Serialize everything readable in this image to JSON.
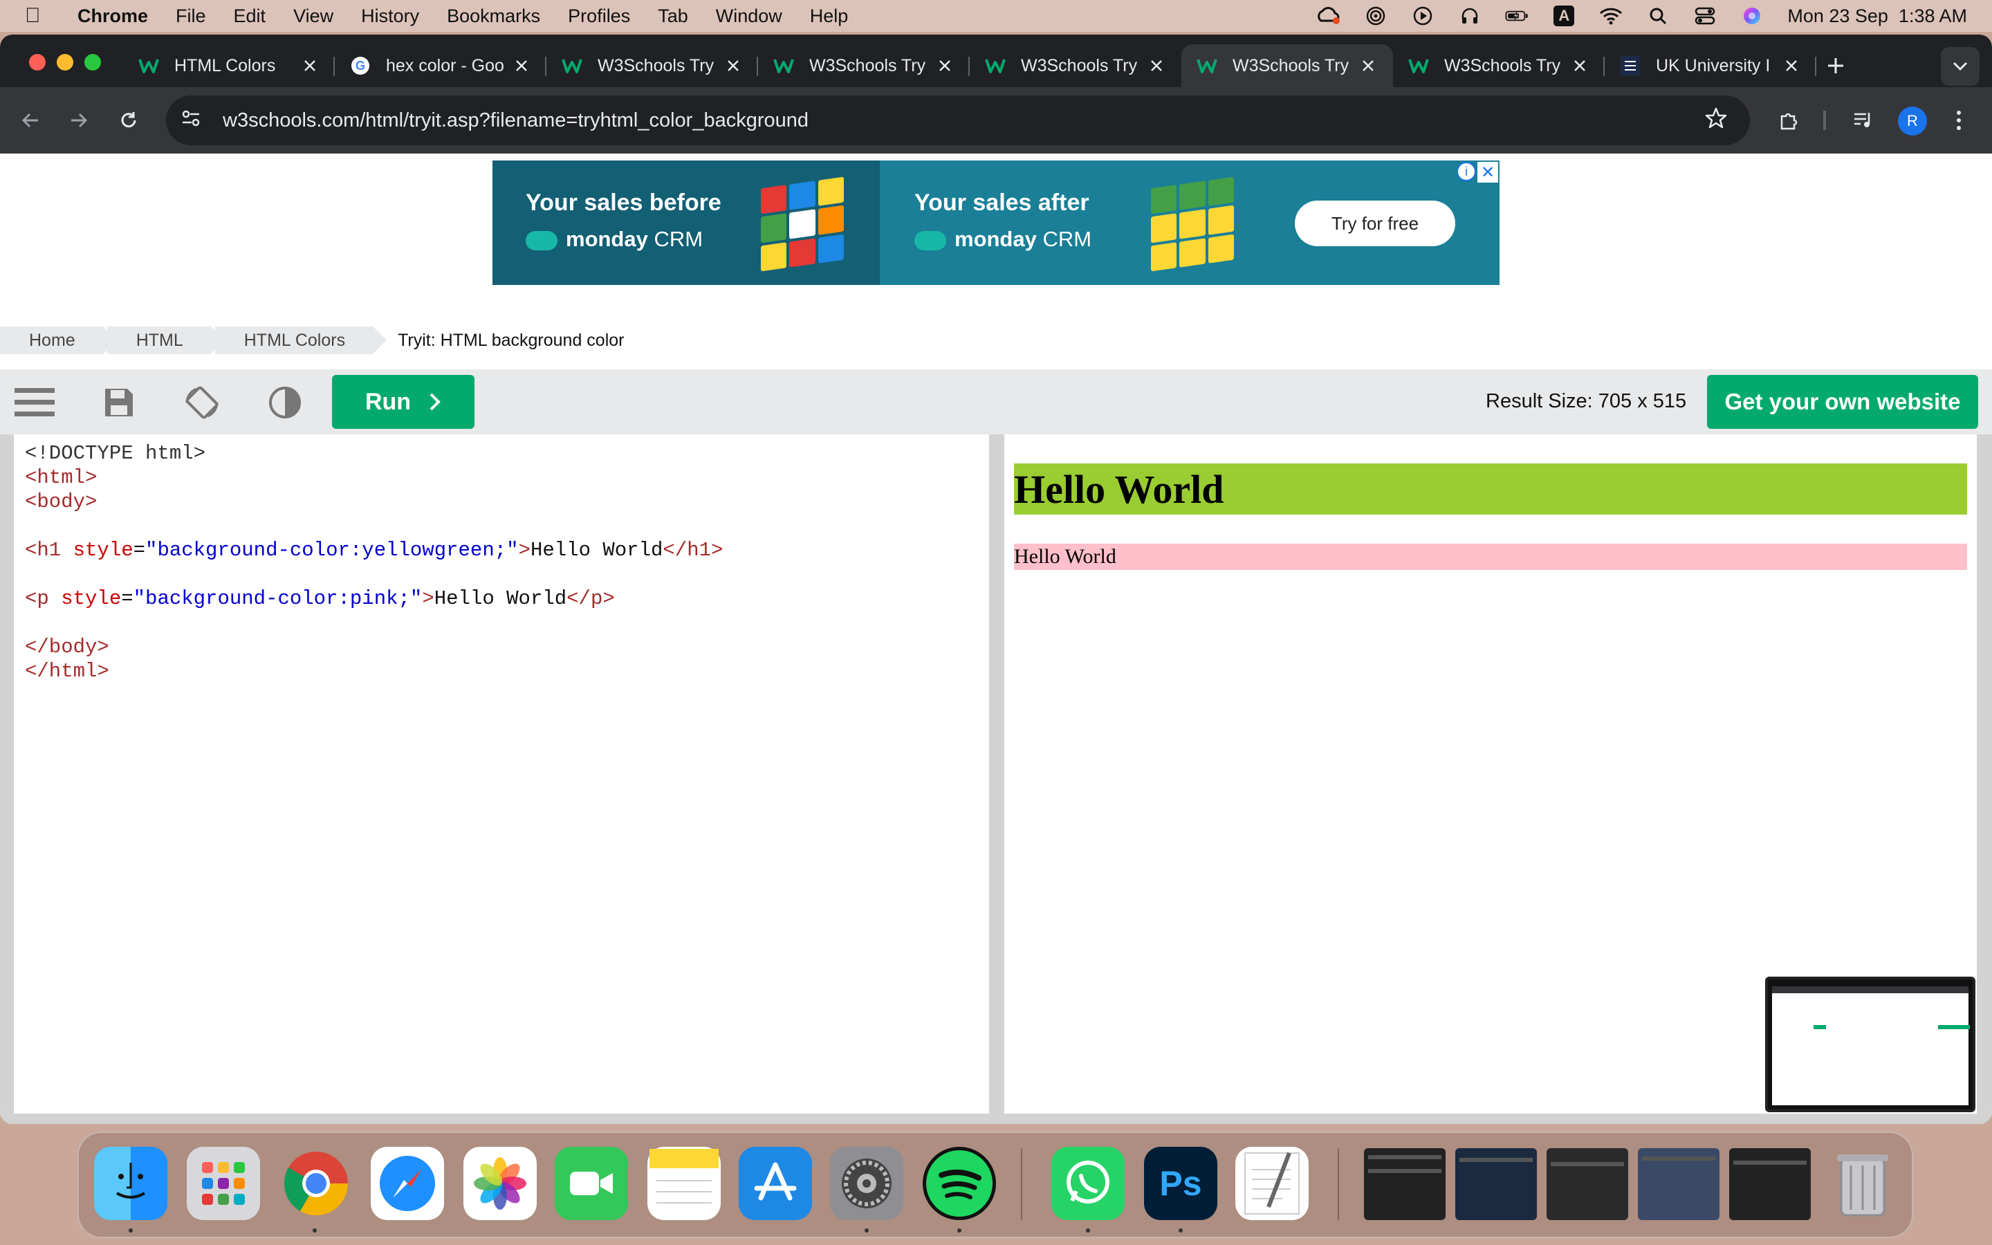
{
  "menubar": {
    "app": "Chrome",
    "items": [
      "File",
      "Edit",
      "View",
      "History",
      "Bookmarks",
      "Profiles",
      "Tab",
      "Window",
      "Help"
    ],
    "status_icons": [
      "creative-cloud-icon",
      "airdrop-icon",
      "play-icon",
      "headphones-icon",
      "battery-icon",
      "input-source-icon",
      "wifi-icon",
      "spotlight-icon",
      "control-center-icon",
      "siri-icon"
    ],
    "input_source": "A",
    "datetime": "Mon 23 Sep  1:38 AM"
  },
  "browser": {
    "tabs": [
      {
        "title": "HTML Colors",
        "favicon": "w3schools-icon"
      },
      {
        "title": "hex color - Goo",
        "favicon": "google-icon"
      },
      {
        "title": "W3Schools Try",
        "favicon": "w3schools-icon"
      },
      {
        "title": "W3Schools Try",
        "favicon": "w3schools-icon"
      },
      {
        "title": "W3Schools Try",
        "favicon": "w3schools-icon"
      },
      {
        "title": "W3Schools Try",
        "favicon": "w3schools-icon",
        "active": true
      },
      {
        "title": "W3Schools Try",
        "favicon": "w3schools-icon"
      },
      {
        "title": "UK University I",
        "favicon": "bath-spa-icon"
      }
    ],
    "url": "w3schools.com/html/tryit.asp?filename=tryhtml_color_background",
    "profile_initial": "R"
  },
  "ad": {
    "before": "Your sales before",
    "after": "Your sales after",
    "brand_bold": "monday",
    "brand_light": "CRM",
    "cta": "Try for free",
    "info": "i",
    "close": "✕"
  },
  "breadcrumb": [
    "Home",
    "HTML",
    "HTML Colors",
    "Tryit: HTML background color"
  ],
  "tryit": {
    "run_label": "Run",
    "result_size": "Result Size: 705 x 515",
    "get_website": "Get your own website"
  },
  "code_lines": [
    [
      {
        "t": "<!DOCTYPE html>",
        "c": "doctype"
      }
    ],
    [
      {
        "t": "<html>",
        "c": "tag"
      }
    ],
    [
      {
        "t": "<body>",
        "c": "tag"
      }
    ],
    [],
    [
      {
        "t": "<h1 ",
        "c": "tag"
      },
      {
        "t": "style",
        "c": "attr"
      },
      {
        "t": "=",
        "c": "plain"
      },
      {
        "t": "\"background-color:yellowgreen;\"",
        "c": "val"
      },
      {
        "t": ">",
        "c": "tag"
      },
      {
        "t": "Hello World",
        "c": "plain"
      },
      {
        "t": "</h1>",
        "c": "tag"
      }
    ],
    [],
    [
      {
        "t": "<p ",
        "c": "tag"
      },
      {
        "t": "style",
        "c": "attr"
      },
      {
        "t": "=",
        "c": "plain"
      },
      {
        "t": "\"background-color:pink;\"",
        "c": "val"
      },
      {
        "t": ">",
        "c": "tag"
      },
      {
        "t": "Hello World",
        "c": "plain"
      },
      {
        "t": "</p>",
        "c": "tag"
      }
    ],
    [],
    [
      {
        "t": "</body>",
        "c": "tag"
      }
    ],
    [
      {
        "t": "</html>",
        "c": "tag"
      }
    ]
  ],
  "result": {
    "h1": "Hello World",
    "h1_bg": "#9acd32",
    "p": "Hello World",
    "p_bg": "#ffc0cb"
  },
  "dock": {
    "apps": [
      "finder-icon",
      "launchpad-icon",
      "chrome-icon",
      "safari-icon",
      "photos-icon",
      "facetime-icon",
      "notes-icon",
      "app-store-icon",
      "system-settings-icon",
      "spotify-icon",
      "whatsapp-icon",
      "photoshop-icon",
      "textedit-icon"
    ],
    "photoshop_label": "Ps"
  },
  "colors": {
    "w3_green": "#04aa6d",
    "chrome_dark": "#202124",
    "chrome_toolbar": "#35363a"
  }
}
